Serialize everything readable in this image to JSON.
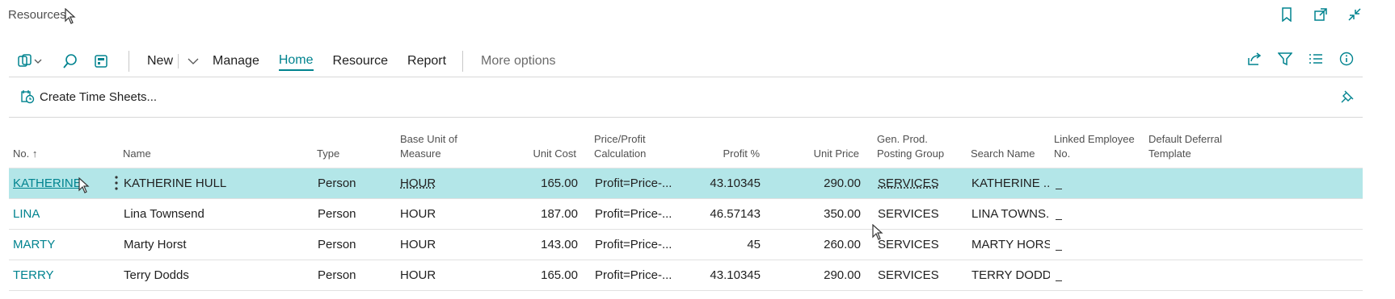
{
  "page": {
    "title": "Resources"
  },
  "actionbar": {
    "items": [
      "New",
      "Manage",
      "Home",
      "Resource",
      "Report"
    ],
    "selected": "Home",
    "more_options": "More options"
  },
  "promoted": {
    "create_time_sheets": "Create Time Sheets..."
  },
  "grid": {
    "headers": {
      "no": "No. ↑",
      "name": "Name",
      "type": "Type",
      "base_unit_1": "Base Unit of",
      "base_unit_2": "Measure",
      "unit_cost": "Unit Cost",
      "price_calc_1": "Price/Profit",
      "price_calc_2": "Calculation",
      "profit": "Profit %",
      "unit_price": "Unit Price",
      "gen_prod_1": "Gen. Prod.",
      "gen_prod_2": "Posting Group",
      "search_name": "Search Name",
      "linked_emp_1": "Linked Employee",
      "linked_emp_2": "No.",
      "deferral_1": "Default Deferral",
      "deferral_2": "Template"
    },
    "rows": [
      {
        "no": "KATHERINE",
        "name": "KATHERINE HULL",
        "type": "Person",
        "uom": "HOUR",
        "unit_cost": "165.00",
        "calc": "Profit=Price-...",
        "profit": "43.10345",
        "unit_price": "290.00",
        "group": "SERVICES",
        "search": "KATHERINE ...",
        "linked": "_",
        "deferral": ""
      },
      {
        "no": "LINA",
        "name": "Lina Townsend",
        "type": "Person",
        "uom": "HOUR",
        "unit_cost": "187.00",
        "calc": "Profit=Price-...",
        "profit": "46.57143",
        "unit_price": "350.00",
        "group": "SERVICES",
        "search": "LINA TOWNS...",
        "linked": "_",
        "deferral": ""
      },
      {
        "no": "MARTY",
        "name": "Marty Horst",
        "type": "Person",
        "uom": "HOUR",
        "unit_cost": "143.00",
        "calc": "Profit=Price-...",
        "profit": "45",
        "unit_price": "260.00",
        "group": "SERVICES",
        "search": "MARTY HORST",
        "linked": "_",
        "deferral": ""
      },
      {
        "no": "TERRY",
        "name": "Terry Dodds",
        "type": "Person",
        "uom": "HOUR",
        "unit_cost": "165.00",
        "calc": "Profit=Price-...",
        "profit": "43.10345",
        "unit_price": "290.00",
        "group": "SERVICES",
        "search": "TERRY DODDS",
        "linked": "_",
        "deferral": ""
      }
    ]
  },
  "colors": {
    "accent": "#00838f",
    "selected_row": "#b3e6e8"
  }
}
